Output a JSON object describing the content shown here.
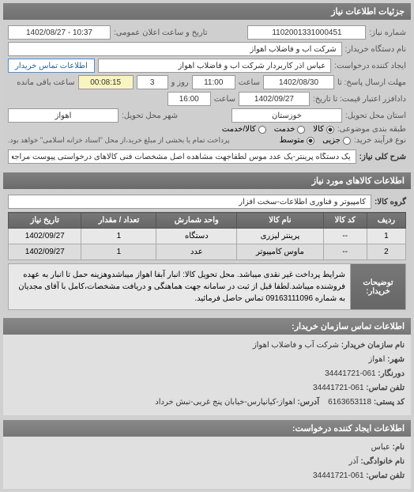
{
  "headerTitle": "جزئیات اطلاعات نیاز",
  "fields": {
    "requestNumberLabel": "شماره نیاز:",
    "requestNumber": "1102001331000451",
    "publicAnnounceLabel": "تاریخ و ساعت اعلان عمومی:",
    "publicAnnounce": "10:37 - 1402/08/27",
    "buyerNameLabel": "نام دستگاه خریدار:",
    "buyerName": "شرکت آب و فاضلاب اهواز",
    "requestCreatorLabel": "ایجاد کننده درخواست:",
    "requestCreator": "عباس آذر کاربردار شرکت آب و فاضلاب اهواز",
    "buyerContactBtn": "اطلاعات تماس خریدار",
    "responseDeadlineLabel": "مهلت ارسال پاسخ: تا",
    "responseDate": "1402/08/30",
    "timeLabel": "ساعت",
    "responseTime": "11:00",
    "andLabel": "روز و",
    "daysLeft": "3",
    "remainingTimeLabel": "ساعت باقی مانده",
    "remainingTime": "00:08:15",
    "priceValidityLabel": "دادافزر اعتبار قیمت: تا تاریخ:",
    "priceDate": "1402/09/27",
    "priceTime": "16:00",
    "deliveryProvinceLabel": "استان محل تحویل:",
    "deliveryProvince": "خوزستان",
    "deliveryCityLabel": "شهر محل تحویل:",
    "deliveryCity": "اهواز",
    "groupingLabel": "طبقه بندی موضوعی:",
    "opt1": "کالا",
    "opt2": "خدمت",
    "opt3": "کالا/خدمت",
    "qtyTypeLabel": "نوع فرآیند خرید:",
    "q1": "جزیی",
    "q2": "متوسط",
    "noteText": "پرداخت تمام یا بخشی از مبلغ خرید،از محل \"اسناد خزانه اسلامی\" خواهد بود.",
    "generalDescLabel": "شرح کلی نیاز:",
    "generalDesc": "یک دستگاه پرینتر-یک عدد موس لطفاجهت مشاهده اصل مشخصات فنی کالاهای درخواستی پیوست مراجعه شود"
  },
  "goodsHeader": "اطلاعات کالاهای مورد نیاز",
  "goodsGroupLabel": "گروه کالا:",
  "goodsGroup": "کامپیوتر و فناوری اطلاعات-سخت افزار",
  "table": {
    "headers": [
      "ردیف",
      "کد کالا",
      "نام کالا",
      "واحد شمارش",
      "تعداد / مقدار",
      "تاریخ نیاز"
    ],
    "rows": [
      [
        "1",
        "--",
        "پرینتر لیزری",
        "دستگاه",
        "1",
        "1402/09/27"
      ],
      [
        "2",
        "--",
        "ماوس کامپیوتر",
        "عدد",
        "1",
        "1402/09/27"
      ]
    ]
  },
  "buyerDescLabel": "توضیحات خریدار:",
  "buyerDesc": "شرایط پرداخت غیر نقدی میباشد. محل تحویل کالا: انبار آبفا اهواز میباشدوهزینه حمل تا انبار به عهده فروشنده میباشد.لطفا قبل از ثبت در سامانه جهت هماهنگی و دریافت مشخصات،کامل با آقای مجدیان به شماره 09163111096 تماس حاصل فرمائید.",
  "contactHeader": "اطلاعات تماس سازمان خریدار:",
  "contact": {
    "orgNameK": "نام سازمان خریدار:",
    "orgNameV": "شرکت آب و فاضلاب اهواز",
    "cityK": "شهر:",
    "cityV": "اهواز",
    "pretelK": "دورنگار:",
    "pretelV": "061-34441721",
    "telK": "تلفن تماس:",
    "telV": "061-34441721",
    "postK": "کد پستی:",
    "postV": "6163653118",
    "addrK": "آدرس:",
    "addrV": "اهواز-کیانپارس-خیابان پنج غربی-نبش خرداد"
  },
  "creatorHeader": "اطلاعات ایجاد کننده درخواست:",
  "creator": {
    "nameK": "نام:",
    "nameV": "عباس",
    "familyK": "نام خانوادگی:",
    "familyV": "آذر",
    "telK": "تلفن تماس:",
    "telV": "061-34441721"
  }
}
